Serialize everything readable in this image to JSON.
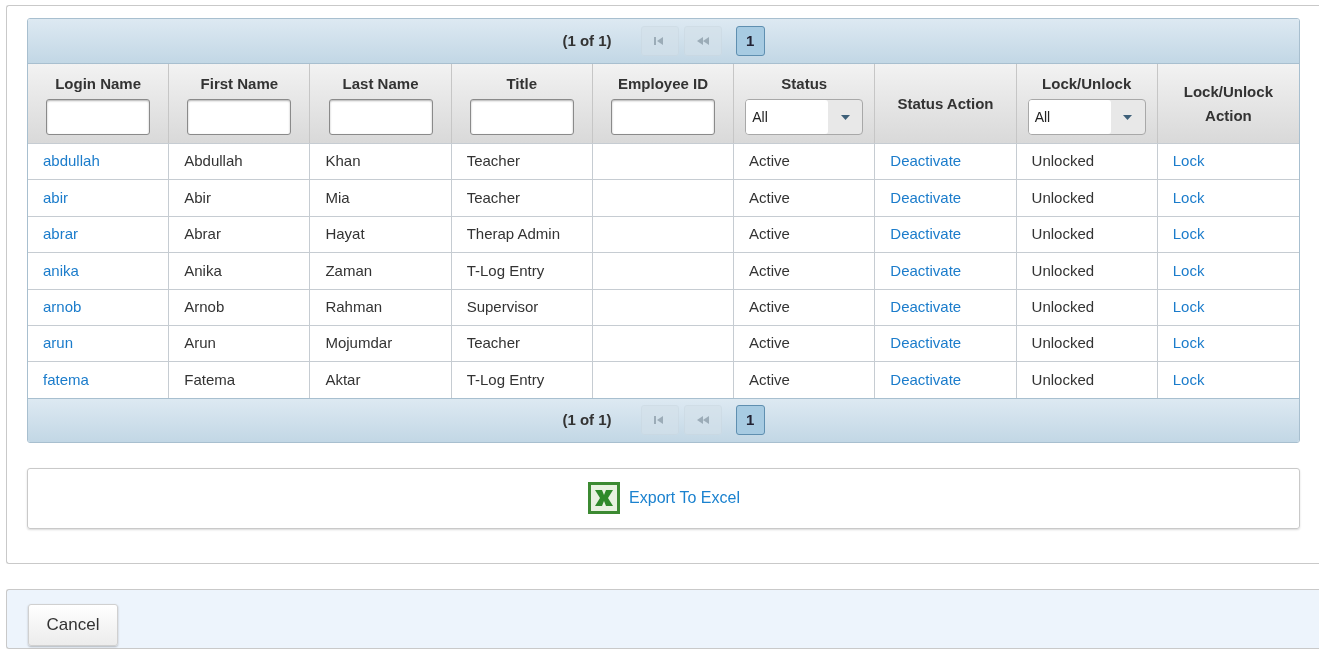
{
  "paginator_top": {
    "summary": "(1 of 1)",
    "buttons": [
      {
        "kind": "first",
        "disabled": true
      },
      {
        "kind": "prev",
        "disabled": true
      }
    ],
    "pages": [
      {
        "label": "1",
        "selected": true
      }
    ]
  },
  "table": {
    "columns": [
      {
        "label": "Login Name",
        "filter": {
          "kind": "text"
        },
        "kind": "link"
      },
      {
        "label": "First Name",
        "filter": {
          "kind": "text"
        },
        "kind": "text"
      },
      {
        "label": "Last Name",
        "filter": {
          "kind": "text"
        },
        "kind": "text"
      },
      {
        "label": "Title",
        "filter": {
          "kind": "text"
        },
        "kind": "text"
      },
      {
        "label": "Employee ID",
        "filter": {
          "kind": "text"
        },
        "kind": "text"
      },
      {
        "label": "Status",
        "filter": {
          "kind": "select",
          "value": "All"
        },
        "kind": "text"
      },
      {
        "label": "Status Action",
        "kind": "link"
      },
      {
        "label": "Lock/Unlock",
        "filter": {
          "kind": "select",
          "value": "All"
        },
        "kind": "text"
      },
      {
        "label": "Lock/Unlock Action",
        "kind": "link"
      }
    ],
    "rows": [
      [
        "abdullah",
        "Abdullah",
        "Khan",
        "Teacher",
        "",
        "Active",
        "Deactivate",
        "Unlocked",
        "Lock"
      ],
      [
        "abir",
        "Abir",
        "Mia",
        "Teacher",
        "",
        "Active",
        "Deactivate",
        "Unlocked",
        "Lock"
      ],
      [
        "abrar",
        "Abrar",
        "Hayat",
        "Therap Admin",
        "",
        "Active",
        "Deactivate",
        "Unlocked",
        "Lock"
      ],
      [
        "anika",
        "Anika",
        "Zaman",
        "T-Log Entry",
        "",
        "Active",
        "Deactivate",
        "Unlocked",
        "Lock"
      ],
      [
        "arnob",
        "Arnob",
        "Rahman",
        "Supervisor",
        "",
        "Active",
        "Deactivate",
        "Unlocked",
        "Lock"
      ],
      [
        "arun",
        "Arun",
        "Mojumdar",
        "Teacher",
        "",
        "Active",
        "Deactivate",
        "Unlocked",
        "Lock"
      ],
      [
        "fatema",
        "Fatema",
        "Aktar",
        "T-Log Entry",
        "",
        "Active",
        "Deactivate",
        "Unlocked",
        "Lock"
      ]
    ]
  },
  "paginator_bottom": {
    "summary": "(1 of 1)",
    "buttons": [
      {
        "kind": "first",
        "disabled": true
      },
      {
        "kind": "prev",
        "disabled": true
      }
    ],
    "pages": [
      {
        "label": "1",
        "selected": true
      }
    ]
  },
  "export": {
    "label": "Export To Excel"
  },
  "cancel_button": "Cancel"
}
